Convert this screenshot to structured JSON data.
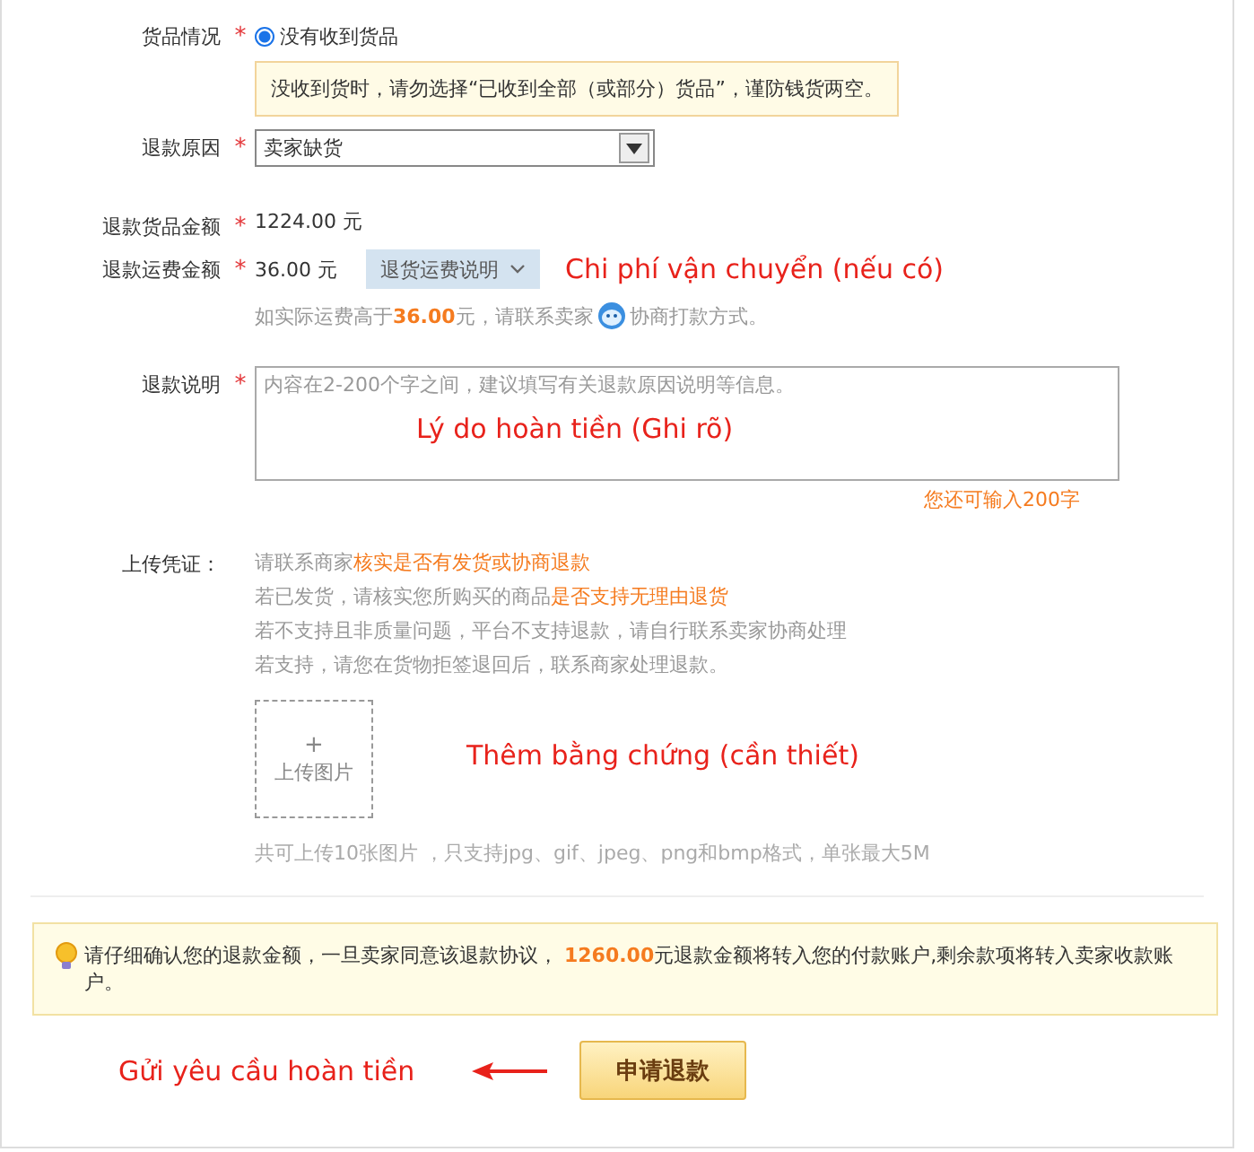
{
  "goods_status": {
    "label": "货品情况",
    "required_mark": "*",
    "options": [
      {
        "label": "没有收到货品",
        "selected": true
      }
    ],
    "warning": "没收到货时，请勿选择“已收到全部（或部分）货品”，谨防钱货两空。"
  },
  "refund_reason": {
    "label": "退款原因",
    "required_mark": "*",
    "value": "卖家缺货"
  },
  "goods_amount": {
    "label": "退款货品金额",
    "required_mark": "*",
    "value": "1224.00 元"
  },
  "shipping_amount": {
    "label": "退款运费金额",
    "required_mark": "*",
    "value": "36.00 元",
    "info_button": "退货运费说明",
    "annotation": "Chi phí vận chuyển (nếu có)",
    "note_before": "如实际运费高于**36.00**元，请联系卖家",
    "note_after": "协商打款方式。"
  },
  "explanation": {
    "label": "退款说明",
    "required_mark": "*",
    "placeholder": "内容在2-200个字之间，建议填写有关退款原因说明等信息。",
    "annotation": "Lý do hoàn tiền (Ghi rõ)",
    "counter": "您还可输入200字"
  },
  "evidence": {
    "label": "上传凭证：",
    "lines": [
      [
        {
          "text": "请联系商家",
          "highlight": false
        },
        {
          "text": "核实是否有发货或协商退款",
          "highlight": true
        }
      ],
      [
        {
          "text": "若已发货，请核实您所购买的商品",
          "highlight": false
        },
        {
          "text": "是否支持无理由退货",
          "highlight": true
        }
      ],
      [
        {
          "text": "若不支持且非质量问题，平台不支持退款，请自行联系卖家协商处理",
          "highlight": false
        }
      ],
      [
        {
          "text": "若支持，请您在货物拒签退回后，联系商家处理退款。",
          "highlight": false
        }
      ]
    ],
    "upload_plus": "+",
    "upload_label": "上传图片",
    "annotation": "Thêm bằng chứng (cần thiết)",
    "limits": "共可上传10张图片 ，只支持jpg、gif、jpeg、png和bmp格式，单张最大5M"
  },
  "notice": "请仔细确认您的退款金额，一旦卖家同意该退款协议， **1260.00**元退款金额将转入您的付款账户,剩余款项将转入卖家收款账户。",
  "submit": {
    "annotation": "Gửi yêu cầu hoàn tiền",
    "button": "申请退款"
  }
}
